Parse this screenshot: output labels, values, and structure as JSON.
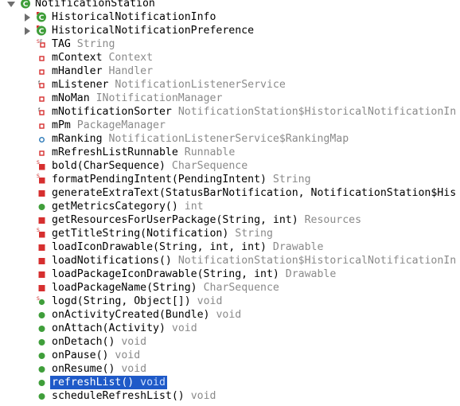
{
  "rows": [
    {
      "name": "NotificationStation",
      "type": "",
      "icon": "class-icon",
      "depth": 0,
      "caret": "down"
    },
    {
      "name": "HistoricalNotificationInfo",
      "type": "",
      "icon": "inner-class-icon",
      "depth": 1,
      "caret": "right"
    },
    {
      "name": "HistoricalNotificationPreference",
      "type": "",
      "icon": "inner-class-icon",
      "depth": 1,
      "caret": "right"
    },
    {
      "name": "TAG",
      "type": "String",
      "icon": "static-final-field-icon",
      "depth": 2
    },
    {
      "name": "mContext",
      "type": "Context",
      "icon": "private-field-icon",
      "depth": 2
    },
    {
      "name": "mHandler",
      "type": "Handler",
      "icon": "private-field-icon",
      "depth": 2
    },
    {
      "name": "mListener",
      "type": "NotificationListenerService",
      "icon": "final-private-field-icon",
      "depth": 2
    },
    {
      "name": "mNoMan",
      "type": "INotificationManager",
      "icon": "private-field-icon",
      "depth": 2
    },
    {
      "name": "mNotificationSorter",
      "type": "NotificationStation$HistoricalNotificationIn",
      "icon": "final-private-field-icon",
      "depth": 2
    },
    {
      "name": "mPm",
      "type": "PackageManager",
      "icon": "private-field-icon",
      "depth": 2
    },
    {
      "name": "mRanking",
      "type": "NotificationListenerService$RankingMap",
      "icon": "default-field-icon",
      "depth": 2
    },
    {
      "name": "mRefreshListRunnable",
      "type": "Runnable",
      "icon": "private-field-icon",
      "depth": 2
    },
    {
      "name": "bold(CharSequence)",
      "type": "CharSequence",
      "icon": "private-static-method-icon",
      "depth": 2
    },
    {
      "name": "formatPendingIntent(PendingIntent)",
      "type": "String",
      "icon": "private-static-method-icon",
      "depth": 2
    },
    {
      "name": "generateExtraText(StatusBarNotification, NotificationStation$His",
      "type": "",
      "icon": "private-method-icon",
      "depth": 2
    },
    {
      "name": "getMetricsCategory()",
      "type": "int",
      "icon": "public-method-icon",
      "depth": 2
    },
    {
      "name": "getResourcesForUserPackage(String, int)",
      "type": "Resources",
      "icon": "private-method-icon",
      "depth": 2
    },
    {
      "name": "getTitleString(Notification)",
      "type": "String",
      "icon": "private-static-method-icon",
      "depth": 2
    },
    {
      "name": "loadIconDrawable(String, int, int)",
      "type": "Drawable",
      "icon": "private-method-icon",
      "depth": 2
    },
    {
      "name": "loadNotifications()",
      "type": "NotificationStation$HistoricalNotificationIn",
      "icon": "private-method-icon",
      "depth": 2
    },
    {
      "name": "loadPackageIconDrawable(String, int)",
      "type": "Drawable",
      "icon": "private-method-icon",
      "depth": 2
    },
    {
      "name": "loadPackageName(String)",
      "type": "CharSequence",
      "icon": "private-method-icon",
      "depth": 2
    },
    {
      "name": "logd(String, Object[])",
      "type": "void",
      "icon": "public-static-method-icon",
      "depth": 2
    },
    {
      "name": "onActivityCreated(Bundle)",
      "type": "void",
      "icon": "public-method-icon",
      "depth": 2
    },
    {
      "name": "onAttach(Activity)",
      "type": "void",
      "icon": "public-method-icon",
      "depth": 2
    },
    {
      "name": "onDetach()",
      "type": "void",
      "icon": "public-method-icon",
      "depth": 2
    },
    {
      "name": "onPause()",
      "type": "void",
      "icon": "public-method-icon",
      "depth": 2
    },
    {
      "name": "onResume()",
      "type": "void",
      "icon": "public-method-icon",
      "depth": 2
    },
    {
      "name": "refreshList()",
      "type": "void",
      "icon": "public-method-icon",
      "depth": 2,
      "selected": true
    },
    {
      "name": "scheduleRefreshList()",
      "type": "void",
      "icon": "public-method-icon",
      "depth": 2
    }
  ],
  "colors": {
    "selection": "#1f5ac8",
    "public": "#3f9e3a",
    "private": "#d62f2f",
    "class": "#3f9e3a",
    "type_text": "#8a8a8a"
  }
}
